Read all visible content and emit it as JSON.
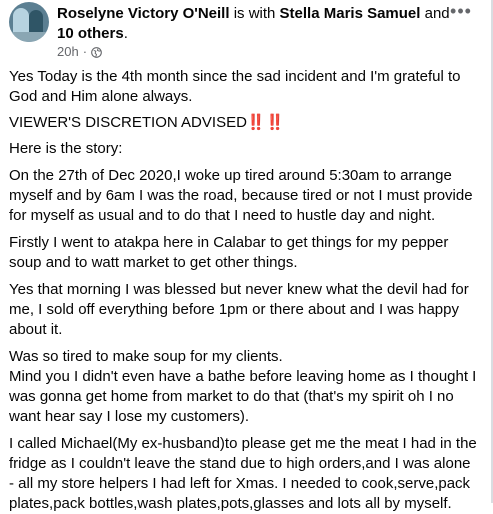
{
  "header": {
    "author": "Roselyne Victory O'Neill",
    "with_text": " is with ",
    "tagged_person": "Stella Maris Samuel",
    "and_text": " and ",
    "others": "10 others",
    "period": ".",
    "time": "20h",
    "dot": "·",
    "privacy_icon": "globe-icon",
    "more_icon": "more-options-icon"
  },
  "post": {
    "paragraphs": [
      "Yes Today is the 4th month since the sad incident and I'm grateful to God and Him alone always.",
      "VIEWER'S DISCRETION ADVISED‼️‼️",
      "Here is the story:",
      "On the 27th of Dec 2020,I woke up tired around 5:30am to arrange myself and by 6am I was the road, because tired or not I must provide for myself as usual and to do that I need to hustle day and night.",
      "Firstly I went to atakpa here in Calabar to get things for my pepper soup and to watt market to get other things.",
      "Yes that morning I was blessed but never knew what the devil had for me, I sold off everything before 1pm or there about and I was happy about it.",
      "Was so tired to make soup for my clients.\nMind you I didn't even have a bathe before leaving home as I  thought I was gonna get home from market to do that (that's my spirit oh I no want hear say I lose my customers).",
      "I called Michael(My ex-husband)to please get me the meat I had in the fridge as I couldn't leave the stand due  to high orders,and I was alone - all my store helpers I had left for Xmas. I needed to cook,serve,pack plates,pack bottles,wash plates,pots,glasses and lots all by myself."
    ]
  }
}
